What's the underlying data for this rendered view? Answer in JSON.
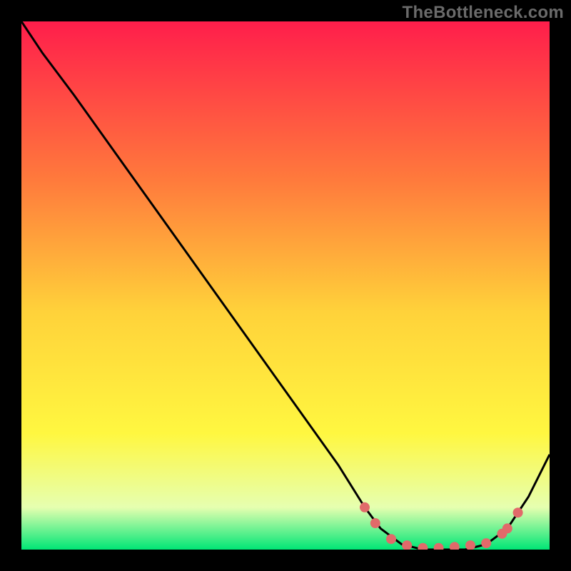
{
  "watermark": "TheBottleneck.com",
  "colors": {
    "gradient_top": "#ff1e4b",
    "gradient_mid1": "#ff7a3c",
    "gradient_mid2": "#ffd23a",
    "gradient_mid3": "#fff740",
    "gradient_bottom_pre": "#e6ffb0",
    "gradient_bottom": "#00e676",
    "curve": "#000000",
    "points": "#e16a6a",
    "frame": "#000000"
  },
  "chart_data": {
    "type": "line",
    "title": "",
    "xlabel": "",
    "ylabel": "",
    "xlim": [
      0,
      100
    ],
    "ylim": [
      0,
      100
    ],
    "series": [
      {
        "name": "bottleneck-curve",
        "x": [
          0,
          4,
          7,
          10,
          20,
          30,
          40,
          50,
          60,
          65,
          68,
          72,
          76,
          80,
          84,
          88,
          92,
          96,
          100
        ],
        "y": [
          100,
          94,
          90,
          86,
          72,
          58,
          44,
          30,
          16,
          8,
          4,
          1,
          0,
          0,
          0,
          1,
          4,
          10,
          18
        ]
      }
    ],
    "points": {
      "name": "marked-points",
      "x": [
        65,
        67,
        70,
        73,
        76,
        79,
        82,
        85,
        88,
        91,
        92,
        94
      ],
      "y": [
        8,
        5,
        2,
        0.8,
        0.3,
        0.3,
        0.5,
        0.8,
        1.2,
        3,
        4,
        7
      ]
    }
  }
}
